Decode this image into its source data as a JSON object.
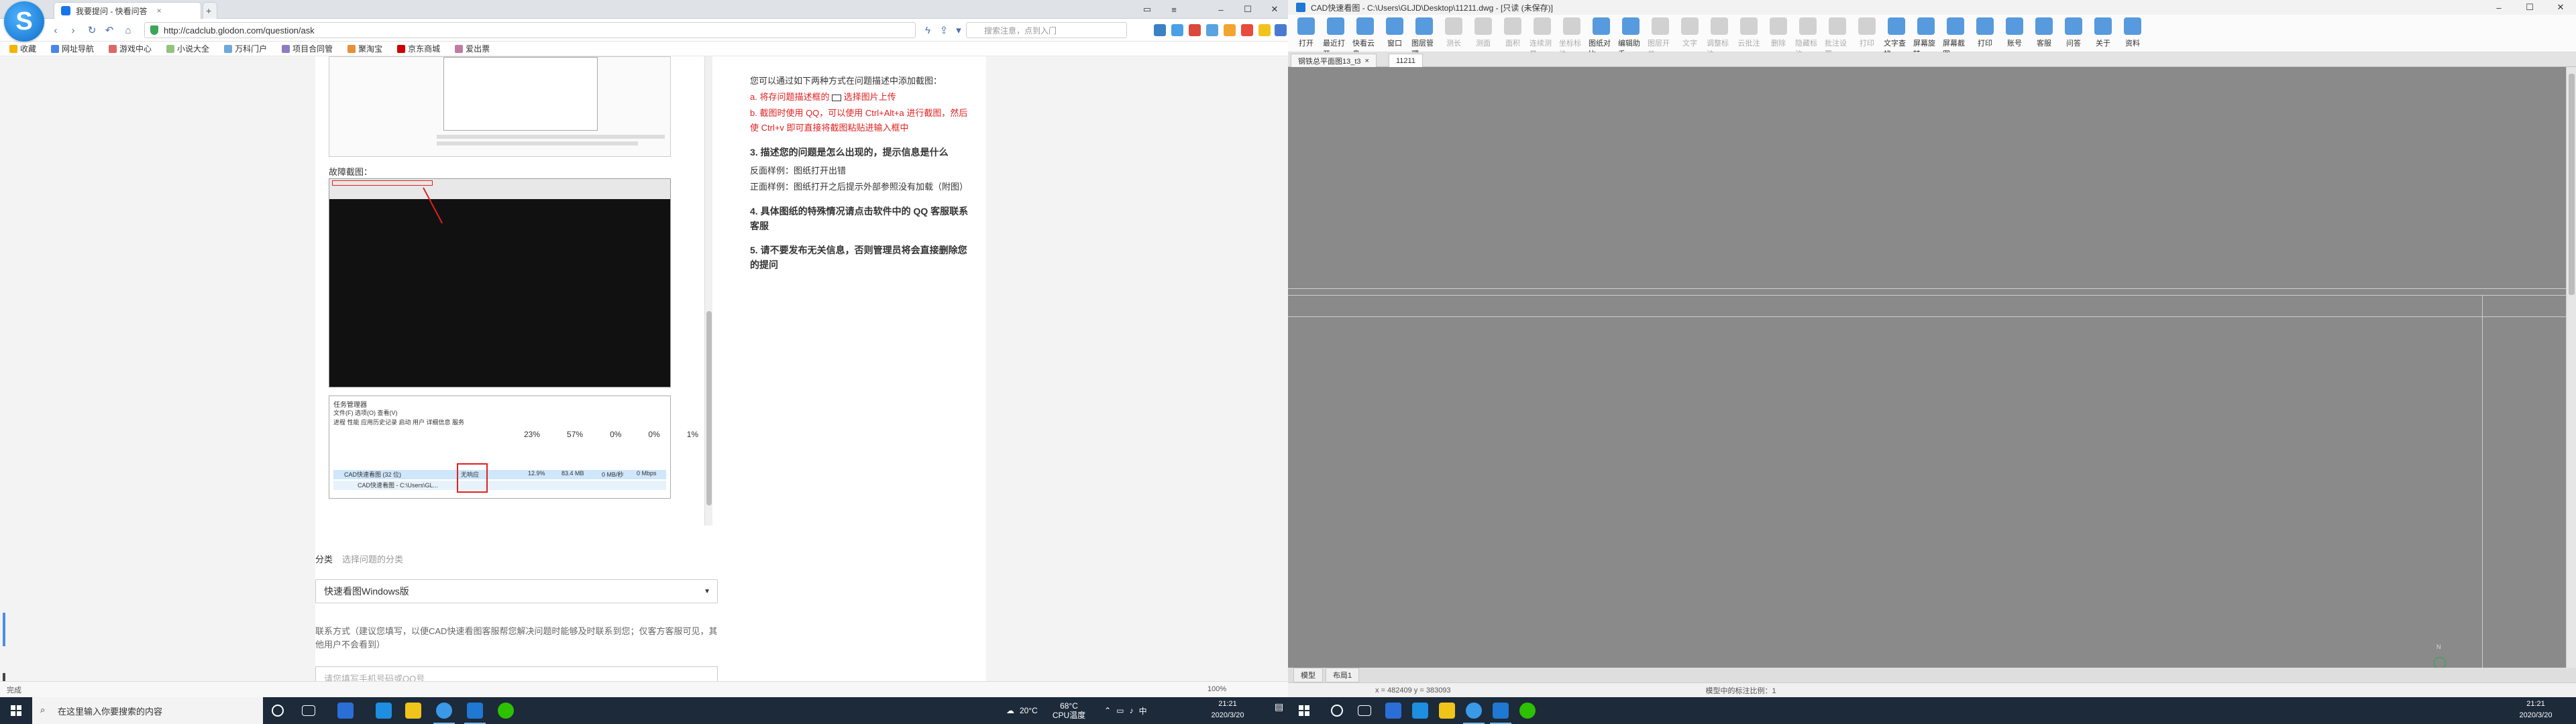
{
  "browser": {
    "tab_active_title": "我要提问 - 快看问答",
    "tab_close_glyph": "×",
    "url": "http://cadclub.glodon.com/question/ask",
    "search_placeholder": "搜索注意，点到入门",
    "bookmarks": [
      "收藏",
      "网址导航",
      "游戏中心",
      "小说大全",
      "万科门户",
      "项目合同管",
      "聚淘宝",
      "京东商城",
      "爱出票"
    ],
    "content": {
      "caption_label": "故障截图：",
      "task_manager_title": "任务管理器",
      "task_manager_menus": "文件(F)   选项(O)   查看(V)",
      "task_manager_tabs": "进程  性能  应用历史记录  启动  用户  详细信息  服务",
      "tm_stats": [
        "23%",
        "57%",
        "0%",
        "0%",
        "1%"
      ],
      "tm_process_row": "CAD快速看图 (32 位)",
      "tm_process_sub": "CAD快速看图 - C:\\Users\\GL...",
      "tm_status_badge": "无响应",
      "tm_cpu": "12.9%",
      "tm_mem": "83.4 MB",
      "tm_disk": "0 MB/秒",
      "tm_net": "0 Mbps",
      "category_label": "分类",
      "category_hint": "选择问题的分类",
      "category_value": "快速看图Windows版",
      "contact_label": "联系方式（建议您填写，以便CAD快速看图客服帮您解决问题时能够及时联系到您；仅客方客服可见，其他用户不会看到）",
      "contact_placeholder": "请您填写手机号码或QQ号"
    },
    "tips": {
      "intro": "您可以通过如下两种方式在问题描述中添加截图：",
      "a": "a. 将存问题描述框的",
      "a2": "选择图片上传",
      "b": "b. 截图时使用 QQ，可以使用 Ctrl+Alt+a 进行截图，然后使 Ctrl+v 即可直接将截图粘贴进输入框中",
      "h3": "3. 描述您的问题是怎么出现的，提示信息是什么",
      "ex1": "反面样例：图纸打开出错",
      "ex2": "正面样例：图纸打开之后提示外部参照没有加载（附图）",
      "h4": "4. 具体图纸的特殊情况请点击软件中的 QQ 客服联系客服",
      "h5": "5. 请不要发布无关信息，否则管理员将会直接删除您的提问"
    },
    "status": {
      "left": "完成",
      "zoom": "100%"
    }
  },
  "cad": {
    "title": "CAD快速看图 - C:\\Users\\GLJD\\Desktop\\11211.dwg - [只读 (未保存)]",
    "ribbon": [
      "打开",
      "最近打开",
      "快看云盘",
      "窗口",
      "图层管理",
      "测长",
      "测面",
      "面积",
      "连续测量",
      "坐标标注",
      "图纸对比",
      "编辑助手",
      "图层开关",
      "文字",
      "调整标注",
      "云批注",
      "删除",
      "隐藏标注",
      "批注设置",
      "打印",
      "文字查找",
      "屏幕旋转",
      "屏幕截图",
      "打印",
      "账号",
      "客服",
      "问答",
      "关于",
      "资料"
    ],
    "ribbon_dim": [
      false,
      false,
      false,
      false,
      false,
      true,
      true,
      true,
      true,
      true,
      false,
      false,
      true,
      true,
      true,
      true,
      true,
      true,
      true,
      true,
      false,
      false,
      false,
      false,
      false,
      false,
      false,
      false,
      false
    ],
    "doc_tab_1": "钢铁总平面图13_t3",
    "doc_tab_2": "11211",
    "bottom_tabs": [
      "模型",
      "布局1"
    ],
    "status_coords": "x = 482409  y = 383093",
    "status_hint": "模型中的标注比例：1"
  },
  "taskbar": {
    "search_placeholder": "在这里输入你要搜索的内容",
    "weather": "20°C",
    "cpu_temp_top": "68°C",
    "cpu_temp_label": "CPU温度",
    "time": "21:21",
    "date": "2020/3/20"
  }
}
